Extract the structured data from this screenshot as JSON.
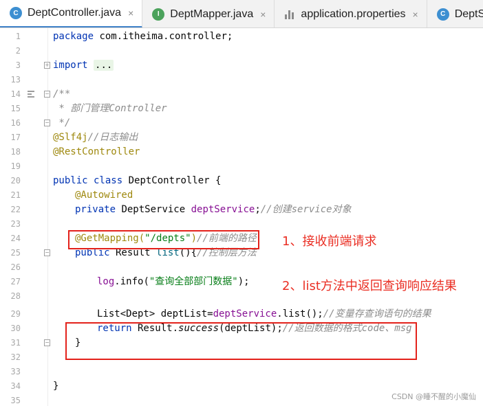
{
  "tabs": [
    {
      "label": "DeptController.java",
      "icon": "class-icon",
      "active": true,
      "close": "×"
    },
    {
      "label": "DeptMapper.java",
      "icon": "interface-icon",
      "active": false,
      "close": "×"
    },
    {
      "label": "application.properties",
      "icon": "properties-icon",
      "active": false,
      "close": "×"
    },
    {
      "label": "DeptS",
      "icon": "class-icon",
      "active": false,
      "close": ""
    }
  ],
  "icon_glyphs": {
    "class": "C",
    "interface": "I"
  },
  "line_numbers": [
    "1",
    "2",
    "3",
    "13",
    "14",
    "15",
    "16",
    "17",
    "18",
    "19",
    "20",
    "21",
    "22",
    "23",
    "24",
    "25",
    "26",
    "27",
    "28",
    "29",
    "30",
    "31",
    "32",
    "33",
    "34",
    "35"
  ],
  "code": {
    "l1_kw": "package",
    "l1_pkg": " com.itheima.controller;",
    "l3_kw": "import",
    "l3_fold": "...",
    "l14": "/**",
    "l15": " * 部门管理Controller",
    "l16": " */",
    "l17_ann": "@Slf4j",
    "l17_cm": "//日志输出",
    "l18_ann": "@RestController",
    "l20_kw": "public class",
    "l20_rest": " DeptController {",
    "l21_ann": "@Autowired",
    "l22_kw": "private",
    "l22_type": " DeptService ",
    "l22_field": "deptService",
    "l22_semi": ";",
    "l22_cm": "//创建service对象",
    "l24_ann": "@GetMapping(",
    "l24_str": "\"/depts\"",
    "l24_close": ")",
    "l24_cm": "//前端的路径",
    "l25_kw": "public",
    "l25_type": " Result ",
    "l25_fn": "list",
    "l25_rest": "(){",
    "l25_cm": "//控制层方法",
    "l27_field": "log",
    "l27_mid": ".info(",
    "l27_str": "\"查询全部部门数据\"",
    "l27_end": ");",
    "l29_a": "List<Dept> deptList=",
    "l29_field": "deptService",
    "l29_b": ".list();",
    "l29_cm": "//变量存查询语句的结果",
    "l30_kw": "return",
    "l30_a": " Result.",
    "l30_st": "success",
    "l30_b": "(deptList);",
    "l30_cm": "//返回数据的格式code、msg",
    "l31": "}",
    "l34": "}"
  },
  "notes": {
    "note1": "1、接收前端请求",
    "note2": "2、list方法中返回查询响应结果"
  },
  "watermark": "CSDN @睡不醒的小魔仙",
  "colors": {
    "keyword": "#0033b3",
    "annotation": "#9e880d",
    "string": "#067d17",
    "comment": "#8c8c8c",
    "field": "#871094",
    "highlight": "#e3211a",
    "active_tab_underline": "#4083c9"
  }
}
